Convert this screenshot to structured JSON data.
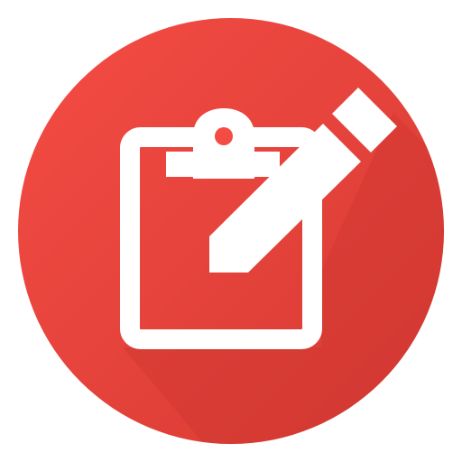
{
  "icon": {
    "name": "clipboard-edit-icon",
    "shape": "circle",
    "colors": {
      "background": "#F44C44",
      "background_shade": "#D63A33",
      "long_shadow": "#C9342E",
      "glyph": "#FFFFFF"
    },
    "glyph_parts": [
      "clipboard",
      "pencil"
    ]
  }
}
